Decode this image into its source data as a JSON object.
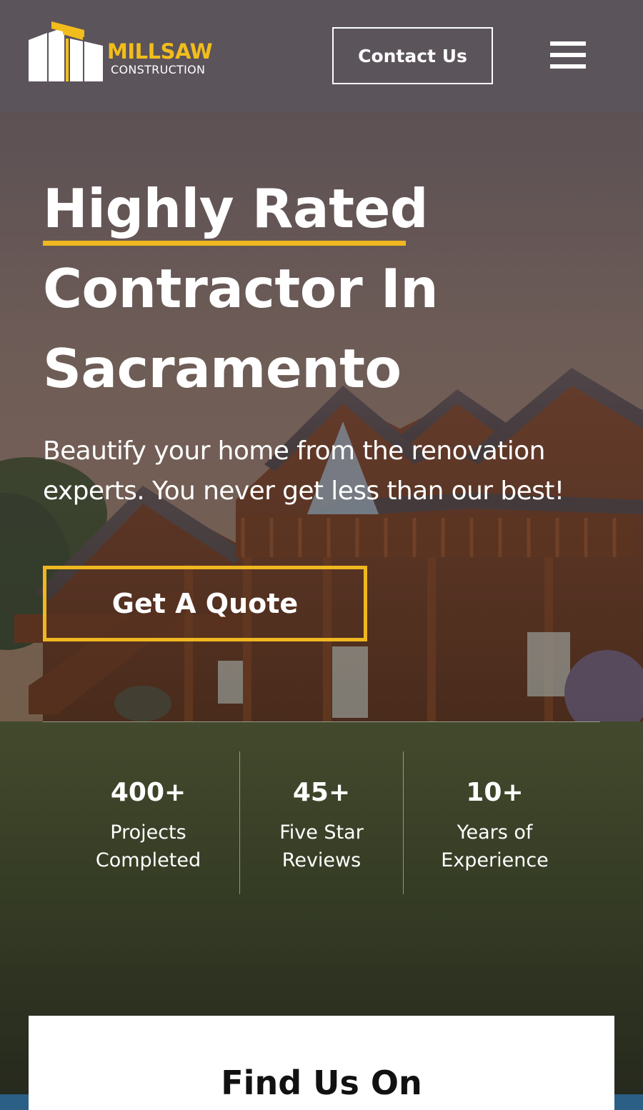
{
  "header": {
    "logo": {
      "name": "MILLSAW",
      "sub": "CONSTRUCTION"
    },
    "contact_label": "Contact Us",
    "menu_icon": "hamburger-icon"
  },
  "hero": {
    "title_lines": [
      "Highly Rated",
      "Contractor In",
      "Sacramento"
    ],
    "subtitle_lines": [
      "Beautify your home from the renovation",
      "experts. You never get less than our best!"
    ],
    "cta_label": "Get A Quote"
  },
  "stats": [
    {
      "value": "400+",
      "label_lines": [
        "Projects",
        "Completed"
      ]
    },
    {
      "value": "45+",
      "label_lines": [
        "Five Star",
        "Reviews"
      ]
    },
    {
      "value": "10+",
      "label_lines": [
        "Years of",
        "Experience"
      ]
    }
  ],
  "find_us": {
    "title": "Find Us On"
  },
  "colors": {
    "accent": "#efb720",
    "header_bg": "#5c565e",
    "text": "#ffffff",
    "band": "#2c5f86"
  }
}
